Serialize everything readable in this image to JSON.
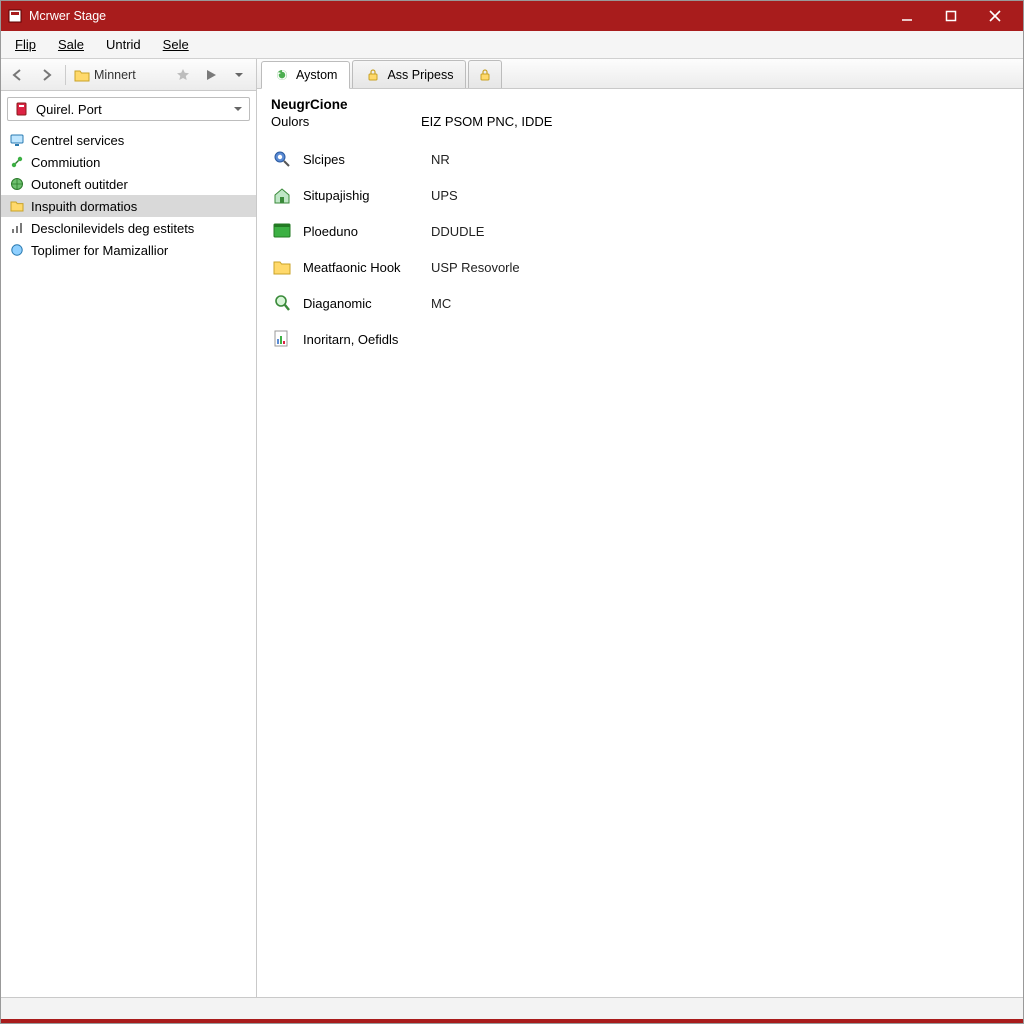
{
  "colors": {
    "accent": "#a81c1c"
  },
  "titlebar": {
    "title": "Mcrwer Stage"
  },
  "menubar": {
    "items": [
      "Flip",
      "Sale",
      "Untrid",
      "Sele"
    ]
  },
  "toolbar": {
    "folder_label": "Minnert"
  },
  "sidebar": {
    "combo_label": "Quirel. Port",
    "nodes": [
      {
        "label": "Centrel services"
      },
      {
        "label": "Commiution"
      },
      {
        "label": "Outoneft outitder"
      },
      {
        "label": "Inspuith dormatios"
      },
      {
        "label": "Desclonilevidels deg estitets"
      },
      {
        "label": "Toplimer for Mamizallior"
      }
    ],
    "selected_index": 3
  },
  "tabs": {
    "items": [
      {
        "label": "Aystom"
      },
      {
        "label": "Ass Pripess"
      },
      {
        "label": ""
      }
    ],
    "active_index": 0
  },
  "main": {
    "header_title": "NeugrCione",
    "header_sub_label": "Oulors",
    "header_sub_value": "EIZ PSOM PNC, IDDE",
    "rows": [
      {
        "key": "Slcipes",
        "value": "NR"
      },
      {
        "key": "Situpajishig",
        "value": "UPS"
      },
      {
        "key": "Ploeduno",
        "value": "DDUDLE"
      },
      {
        "key": "Meatfaonic Hook",
        "value": "USP Resovorle"
      },
      {
        "key": "Diaganomic",
        "value": "MC"
      },
      {
        "key": "Inoritarn, Oefidls",
        "value": ""
      }
    ]
  }
}
